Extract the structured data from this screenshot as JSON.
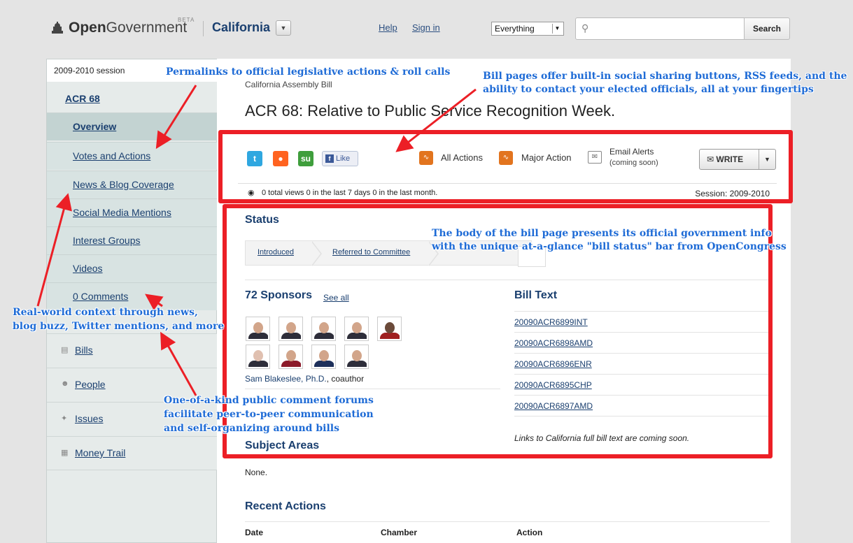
{
  "header": {
    "logo_bold": "Open",
    "logo_light": "Government",
    "beta": "BETA",
    "state": "California",
    "help": "Help",
    "sign_in": "Sign in",
    "scope_value": "Everything",
    "search_placeholder": "",
    "search_button": "Search"
  },
  "sidebar": {
    "session": "2009-2010 session",
    "bill_id": "ACR 68",
    "nav": [
      "Overview",
      "Votes and Actions",
      "News & Blog Coverage",
      "Social Media Mentions",
      "Interest Groups",
      "Videos",
      "0 Comments"
    ],
    "global_nav": [
      {
        "label": "Bills",
        "icon": "bills-icon"
      },
      {
        "label": "People",
        "icon": "people-icon"
      },
      {
        "label": "Issues",
        "icon": "issues-icon"
      },
      {
        "label": "Money Trail",
        "icon": "money-trail-icon"
      }
    ]
  },
  "bill": {
    "kicker": "California Assembly Bill",
    "title": "ACR 68: Relative to Public Service Recognition Week."
  },
  "toolbar": {
    "like": "Like",
    "all_actions": "All Actions",
    "major_action": "Major Action",
    "email_alerts": "Email Alerts",
    "email_alerts_sub": "(coming soon)",
    "write": "WRITE"
  },
  "stats": {
    "views": "0 total views   0 in the last 7 days   0 in the last month.",
    "session": "Session: 2009-2010"
  },
  "status": {
    "heading": "Status",
    "steps": [
      "Introduced",
      "Referred to Committee"
    ]
  },
  "sponsors": {
    "heading": "72 Sponsors",
    "see_all": "See all",
    "coauthor_name": "Sam Blakeslee, Ph.D.",
    "coauthor_role": ", coauthor"
  },
  "bill_text": {
    "heading": "Bill Text",
    "links": [
      "20090ACR6899INT",
      "20090ACR6898AMD",
      "20090ACR6896ENR",
      "20090ACR6895CHP",
      "20090ACR6897AMD"
    ],
    "note": "Links to California full bill text are coming soon."
  },
  "subject": {
    "heading": "Subject Areas",
    "value": "None."
  },
  "recent": {
    "heading": "Recent Actions",
    "columns": [
      "Date",
      "Chamber",
      "Action"
    ]
  },
  "annotations": {
    "permalinks": "Permalinks to official legislative actions & roll calls",
    "social_1": "Bill pages offer built-in social sharing buttons, RSS feeds, and the",
    "social_2": "ability to contact your elected officials, all at your fingertips",
    "body_1": "The body of the bill page presents its official government info",
    "body_2": "with the unique at-a-glance \"bill status\" bar from OpenCongress",
    "context_1": "Real-world context through news,",
    "context_2": "blog buzz, Twitter mentions, and more",
    "forums_1": "One-of-a-kind public comment forums",
    "forums_2": "facilitate peer-to-peer communication",
    "forums_3": "and self-organizing around bills"
  },
  "colors": {
    "annotation_box": "#ec1f26",
    "annotation_text": "#1e6bd6",
    "link": "#1a3f6f",
    "sidebar_bg": "#e6ebea"
  }
}
